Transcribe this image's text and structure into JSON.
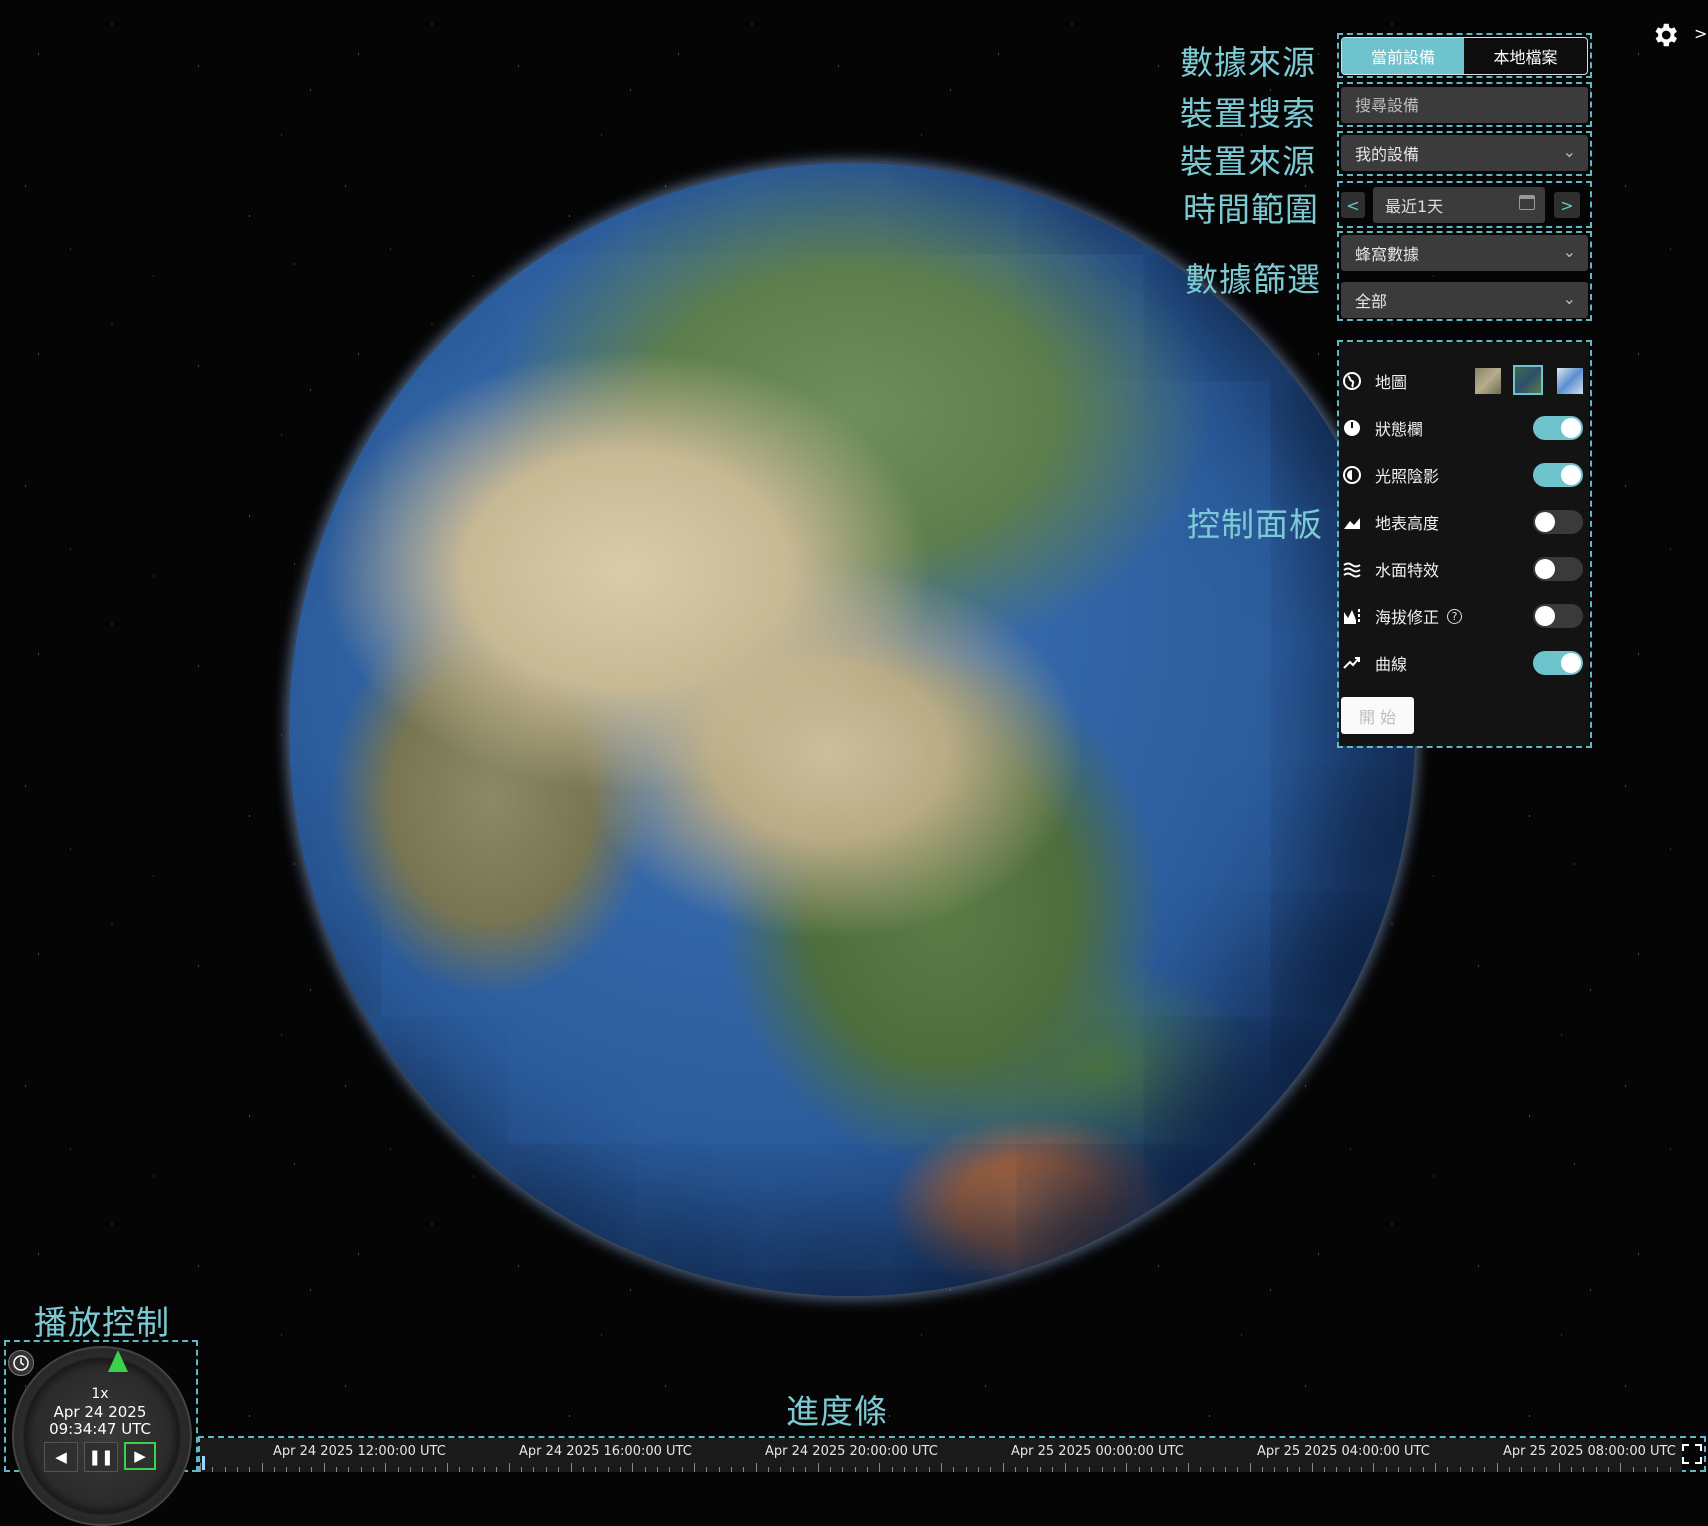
{
  "labels": {
    "data_source": "數據來源",
    "device_search": "裝置搜索",
    "device_source": "裝置來源",
    "time_range": "時間範圍",
    "data_filter": "數據篩選",
    "control_panel": "控制面板",
    "playback_control": "播放控制",
    "progress_bar": "進度條"
  },
  "source_tabs": {
    "current": "當前設備",
    "local": "本地檔案"
  },
  "search": {
    "placeholder": "搜尋設備"
  },
  "device_source": {
    "value": "我的設備"
  },
  "time_range": {
    "value": "最近1天",
    "prev": "<",
    "next": ">"
  },
  "filters": {
    "type": "蜂窩數據",
    "scope": "全部"
  },
  "controls": {
    "map": "地圖",
    "status_bar": "狀態欄",
    "lighting": "光照陰影",
    "terrain": "地表高度",
    "water": "水面特效",
    "altitude": "海拔修正",
    "curve": "曲線",
    "start": "開 始"
  },
  "toggles": {
    "status_bar": true,
    "lighting": true,
    "terrain": false,
    "water": false,
    "altitude": false,
    "curve": true
  },
  "clock": {
    "speed": "1x",
    "date": "Apr 24 2025",
    "time": "09:34:47 UTC"
  },
  "timeline": {
    "ticks": [
      "Apr 24 2025 12:00:00 UTC",
      "Apr 24 2025 16:00:00 UTC",
      "Apr 24 2025 20:00:00 UTC",
      "Apr 25 2025 00:00:00 UTC",
      "Apr 25 2025 04:00:00 UTC",
      "Apr 25 2025 08:00:00 UTC"
    ]
  },
  "colors": {
    "accent": "#6fc3cd",
    "label": "#7ccbd4",
    "dash": "#5fb8c4"
  }
}
